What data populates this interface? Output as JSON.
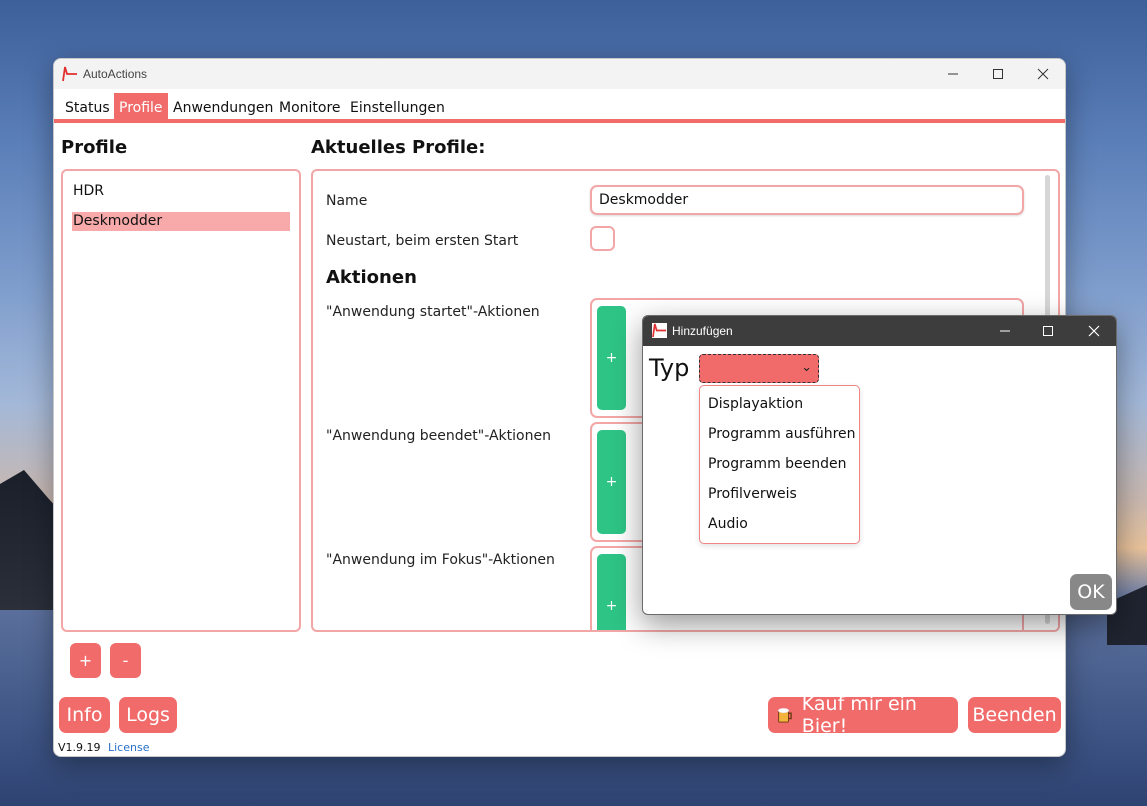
{
  "main_window": {
    "title": "AutoActions",
    "tabs": [
      "Status",
      "Profile",
      "Anwendungen",
      "Monitore",
      "Einstellungen"
    ],
    "active_tab": "Profile",
    "profiles_heading": "Profile",
    "profiles": [
      "HDR",
      "Deskmodder"
    ],
    "selected_profile": "Deskmodder",
    "add_profile_label": "+",
    "remove_profile_label": "-",
    "current_heading": "Aktuelles Profile:",
    "name_label": "Name",
    "name_value": "Deskmodder",
    "restart_label": "Neustart, beim ersten Start",
    "actions_heading": "Aktionen",
    "action_groups": [
      {
        "label": "\"Anwendung startet\"-Aktionen",
        "add_label": "+"
      },
      {
        "label": "\"Anwendung beendet\"-Aktionen",
        "add_label": "+"
      },
      {
        "label": "\"Anwendung im Fokus\"-Aktionen",
        "add_label": "+"
      }
    ],
    "info_button": "Info",
    "logs_button": "Logs",
    "beer_button": "Kauf mir ein Bier!",
    "quit_button": "Beenden",
    "version": "V1.9.19",
    "license_link": "License"
  },
  "dialog": {
    "title": "Hinzufügen",
    "type_label": "Typ",
    "type_options": [
      "Displayaktion",
      "Programm ausführen",
      "Programm beenden",
      "Profilverweis",
      "Audio"
    ],
    "ok_button": "OK"
  },
  "colors": {
    "accent": "#f16b6b",
    "accent_light": "#f8a9a9",
    "green": "#2ec486",
    "dialog_titlebar": "#3d3d3d"
  }
}
